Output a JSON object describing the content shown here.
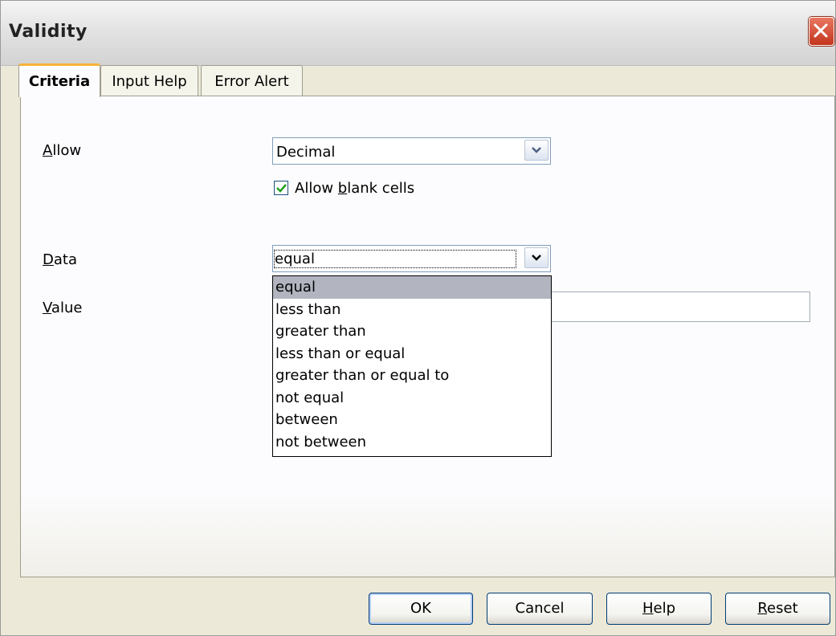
{
  "window": {
    "title": "Validity"
  },
  "tabs": [
    {
      "label": "Criteria",
      "active": true
    },
    {
      "label": "Input Help",
      "active": false
    },
    {
      "label": "Error Alert",
      "active": false
    }
  ],
  "criteria": {
    "allow_label": "Allow",
    "allow_value": "Decimal",
    "allow_blank_label": "Allow blank cells",
    "allow_blank_checked": true,
    "data_label": "Data",
    "data_value": "equal",
    "value_label": "Value",
    "value_text": "",
    "data_options": [
      "equal",
      "less than",
      "greater than",
      "less than or equal",
      "greater than or equal to",
      "not equal",
      "between",
      "not between"
    ],
    "selected_option": "equal"
  },
  "buttons": {
    "ok": "OK",
    "cancel": "Cancel",
    "help": "Help",
    "reset": "Reset"
  },
  "icons": {
    "close": "close-icon",
    "dropdown": "chevron-down-icon",
    "check": "checkmark-icon"
  }
}
